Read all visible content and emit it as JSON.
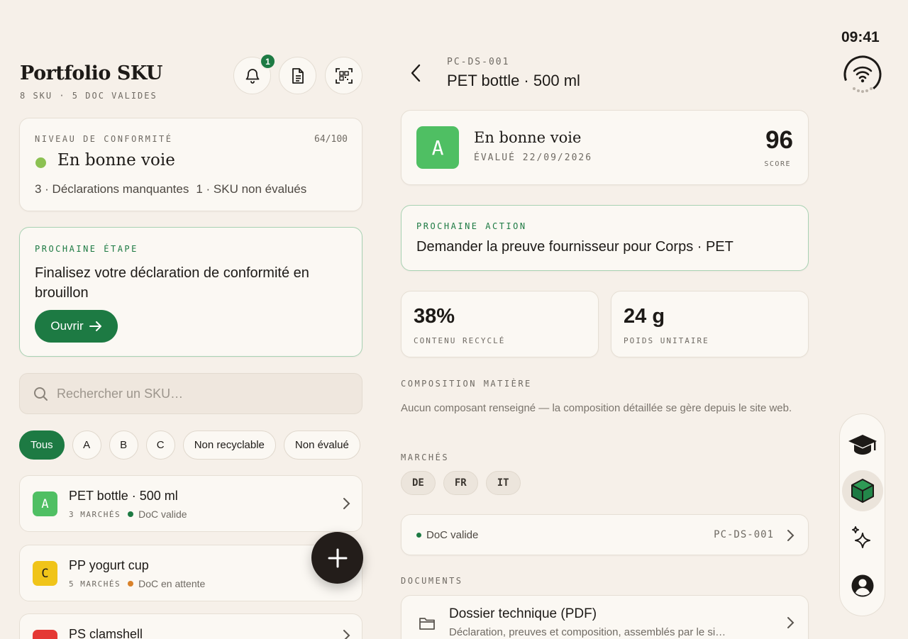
{
  "status_bar": {
    "time": "09:41"
  },
  "portfolio": {
    "title": "Portfolio SKU",
    "subtitle": "8 SKU · 5 DOC VALIDES",
    "notification_count": "1",
    "compliance": {
      "kicker": "NIVEAU DE CONFORMITÉ",
      "score": "64/100",
      "status": "En bonne voie",
      "status_color": "#8cc152",
      "summary_a": "3 · Déclarations manquantes",
      "summary_b": "1 · SKU non évalués"
    },
    "next_step": {
      "kicker": "PROCHAINE ÉTAPE",
      "text": "Finalisez votre déclaration de conformité en brouillon",
      "button": "Ouvrir"
    },
    "search": {
      "placeholder": "Rechercher un SKU…"
    },
    "filters": [
      "Tous",
      "A",
      "B",
      "C",
      "Non recyclable",
      "Non évalué"
    ],
    "skus": [
      {
        "grade": "A",
        "grade_color": "#4fbf63",
        "name": "PET bottle · 500 ml",
        "markets": "3 MARCHÉS",
        "doc": "DoC valide",
        "doc_color": "#1d7a43"
      },
      {
        "grade": "C",
        "grade_color": "#f0c419",
        "name": "PP yogurt cup",
        "markets": "5 MARCHÉS",
        "doc": "DoC en attente",
        "doc_color": "#d9822b"
      },
      {
        "grade": "",
        "grade_color": "#e53935",
        "name": "PS clamshell",
        "markets": "",
        "doc": "",
        "doc_color": "#6f6a63"
      }
    ]
  },
  "detail": {
    "code": "PC-DS-001",
    "title": "PET bottle · 500 ml",
    "grade": "A",
    "status": "En bonne voie",
    "evaluated": "ÉVALUÉ 22/09/2026",
    "score": "96",
    "score_label": "SCORE",
    "next_action": {
      "kicker": "PROCHAINE ACTION",
      "text": "Demander la preuve fournisseur pour Corps · PET"
    },
    "stats": [
      {
        "value": "38%",
        "label": "CONTENU RECYCLÉ"
      },
      {
        "value": "24 g",
        "label": "POIDS UNITAIRE"
      }
    ],
    "composition": {
      "kicker": "COMPOSITION MATIÈRE",
      "text": "Aucun composant renseigné — la composition détaillée se gère depuis le site web."
    },
    "markets": {
      "kicker": "MARCHÉS",
      "items": [
        "DE",
        "FR",
        "IT"
      ]
    },
    "doc": {
      "status": "DoC valide",
      "code": "PC-DS-001"
    },
    "documents": {
      "kicker": "DOCUMENTS",
      "items": [
        {
          "title": "Dossier technique (PDF)",
          "subtitle": "Déclaration, preuves et composition, assemblés par le si…"
        }
      ]
    }
  },
  "colors": {
    "accent": "#1d7a43",
    "background": "#f6f0e9",
    "card": "#fbf8f3"
  }
}
